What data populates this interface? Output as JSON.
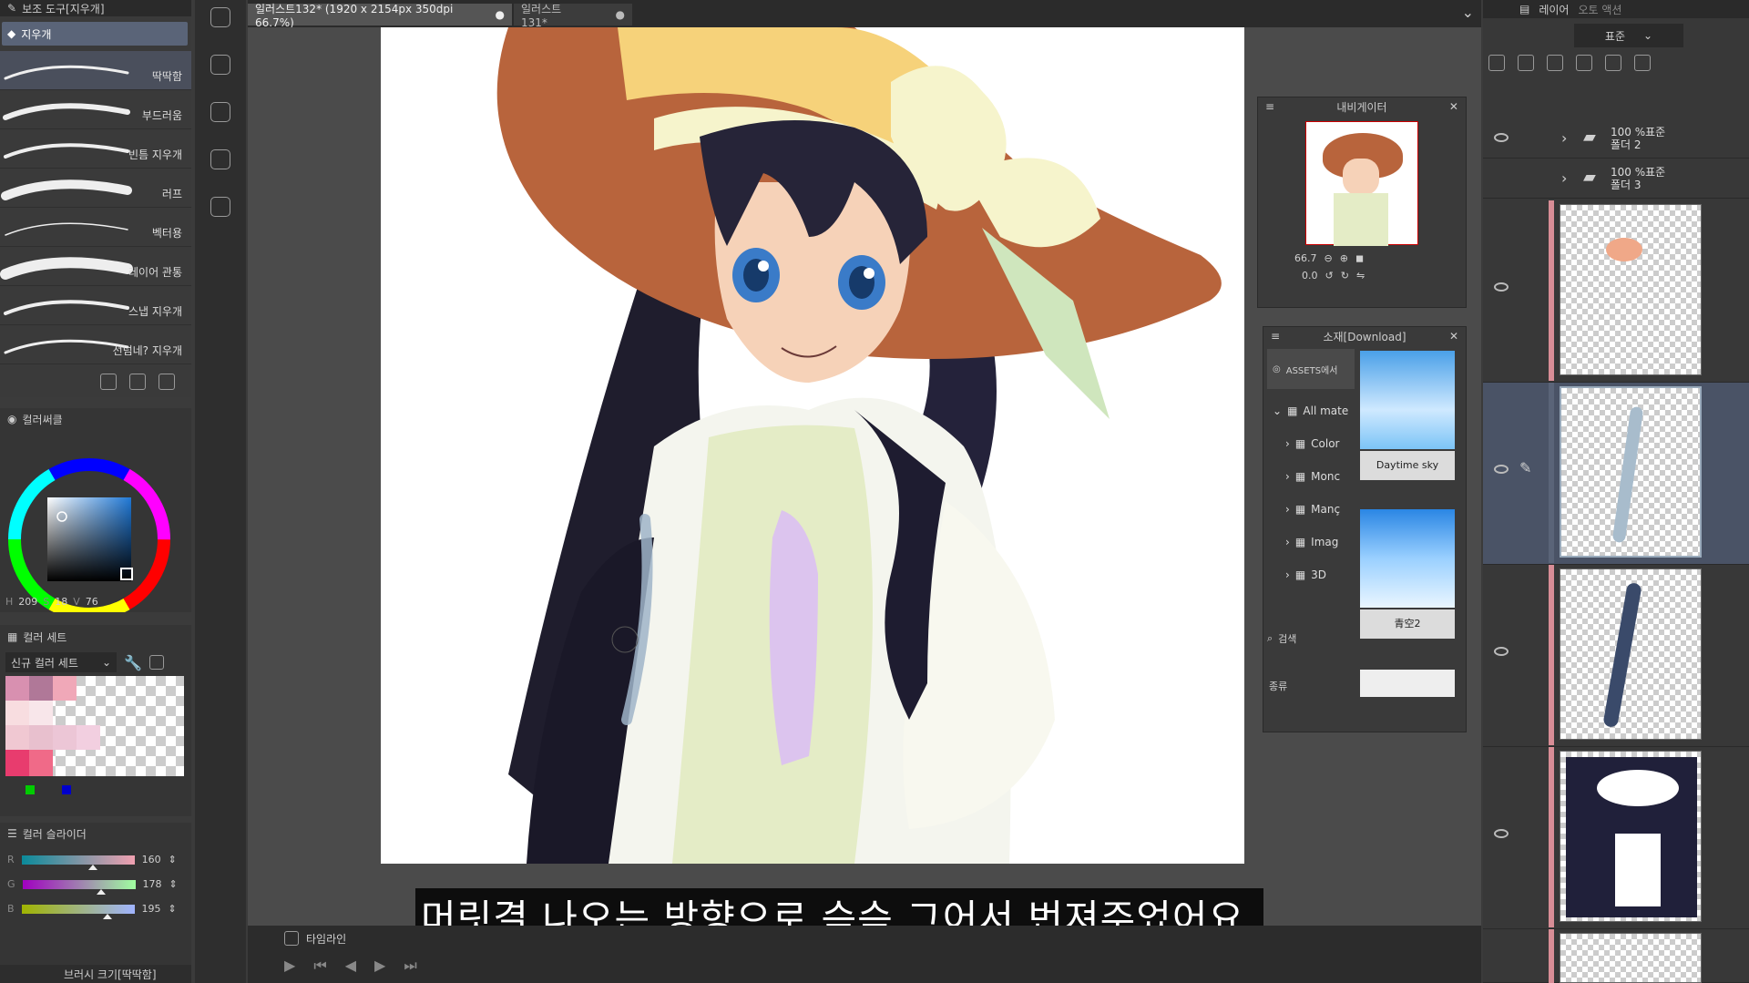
{
  "subtool": {
    "header": "보조 도구[지우개]",
    "group": "지우개",
    "brushes": [
      "딱딱함",
      "부드러움",
      "빈틈 지우개",
      "러프",
      "벡터용",
      "레이어 관통",
      "스냅 지우개",
      "선넘네? 지우개"
    ]
  },
  "colorwheel": {
    "title": "컬러써클",
    "hsv": {
      "h_label": "H",
      "h": "209",
      "s_label": "S",
      "s": "18",
      "v_label": "V",
      "v": "76"
    }
  },
  "colorset": {
    "tab1": "컬러 세트",
    "dropdown": "신규 컬러 세트"
  },
  "colorslider": {
    "title": "컬러 슬라이더",
    "r_label": "R",
    "r": "160",
    "r_fraction": 0.63,
    "g_label": "G",
    "g": "178",
    "g_fraction": 0.7,
    "b_label": "B",
    "b": "195",
    "b_fraction": 0.76
  },
  "bottombrush": {
    "label": "브러시 크기[딱딱함]"
  },
  "tabs": [
    {
      "label": "일러스트132* (1920 x 2154px 350dpi 66.7%)"
    },
    {
      "label": "일러스트131*"
    }
  ],
  "timeline": {
    "label": "타임라인"
  },
  "subtitle": "머릿결 나오는 방향으로 슥슥 그어서 번져주었어요.",
  "navigator": {
    "title": "내비게이터",
    "zoom": "66.7",
    "rotation": "0.0"
  },
  "material": {
    "title": "소재[Download]",
    "assets": "ASSETS에서",
    "tree": [
      "All mate",
      "Color",
      "Monc",
      "Manç",
      "Imag",
      "3D"
    ],
    "search": "검색",
    "kind": "종류",
    "items": [
      {
        "name": "Daytime sky"
      },
      {
        "name": "青空2"
      }
    ]
  },
  "layers": {
    "header": "레이어",
    "header2": "오토 액션",
    "blend": "표준",
    "folders": [
      {
        "line1": "100 %표준",
        "line2": "폴더 2"
      },
      {
        "line1": "100 %표준",
        "line2": "폴더 3"
      }
    ]
  },
  "colors": {
    "accent": "#5a6478",
    "pink_bar": "#d88d96",
    "selected_layer": "#4a5366"
  }
}
